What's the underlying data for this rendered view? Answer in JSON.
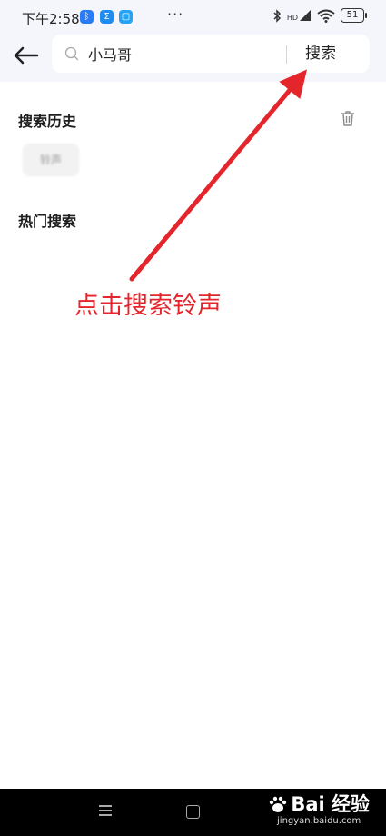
{
  "status_bar": {
    "time": "下午2:58",
    "app_icons": [
      {
        "icon": "bluetooth-app-icon",
        "glyph": "ᛒ",
        "color": "#2a7cf6"
      },
      {
        "icon": "sigma-app-icon",
        "glyph": "Σ",
        "color": "#1f8cf0"
      },
      {
        "icon": "chat-app-icon",
        "glyph": "▢",
        "color": "#27a3f3"
      }
    ],
    "more_indicator": "···",
    "network_label": "HD",
    "battery_level": "51"
  },
  "search": {
    "query": "小马哥",
    "submit_label": "搜索"
  },
  "history": {
    "title": "搜索历史",
    "items": [
      "铃声"
    ]
  },
  "hot": {
    "title": "热门搜索"
  },
  "annotation": {
    "text": "点击搜索铃声",
    "color": "#e4262c"
  },
  "watermark": {
    "brand": "Bai 经验",
    "url": "jingyan.baidu.com"
  }
}
